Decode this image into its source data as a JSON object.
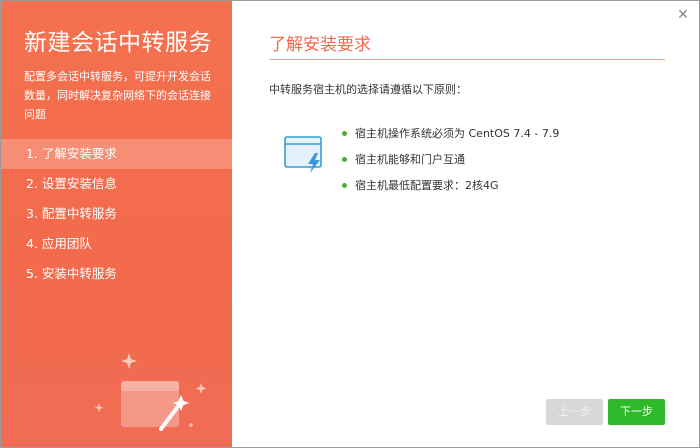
{
  "sidebar": {
    "title": "新建会话中转服务",
    "description": "配置多会话中转服务，可提升开发会话数量，同时解决复杂网络下的会话连接问题",
    "steps": [
      {
        "label": "1. 了解安装要求"
      },
      {
        "label": "2. 设置安装信息"
      },
      {
        "label": "3. 配置中转服务"
      },
      {
        "label": "4. 应用团队"
      },
      {
        "label": "5. 安装中转服务"
      }
    ],
    "active_step": 0
  },
  "main": {
    "section_title": "了解安装要求",
    "intro": "中转服务宿主机的选择请遵循以下原则：",
    "requirements": [
      "宿主机操作系统必须为 CentOS 7.4 - 7.9",
      "宿主机能够和门户互通",
      "宿主机最低配置要求：2核4G"
    ]
  },
  "buttons": {
    "prev": "上一步",
    "next": "下一步"
  },
  "colors": {
    "accent": "#f06a4d",
    "sidebar_bg": "#f4714f",
    "bullet": "#4cae34",
    "next_button": "#2fb82a",
    "prev_button_disabled": "#d8d8d8"
  },
  "icons": {
    "close": "close-icon",
    "requirement": "browser-lightning-icon",
    "illustration": "magic-wand-window-icon"
  }
}
